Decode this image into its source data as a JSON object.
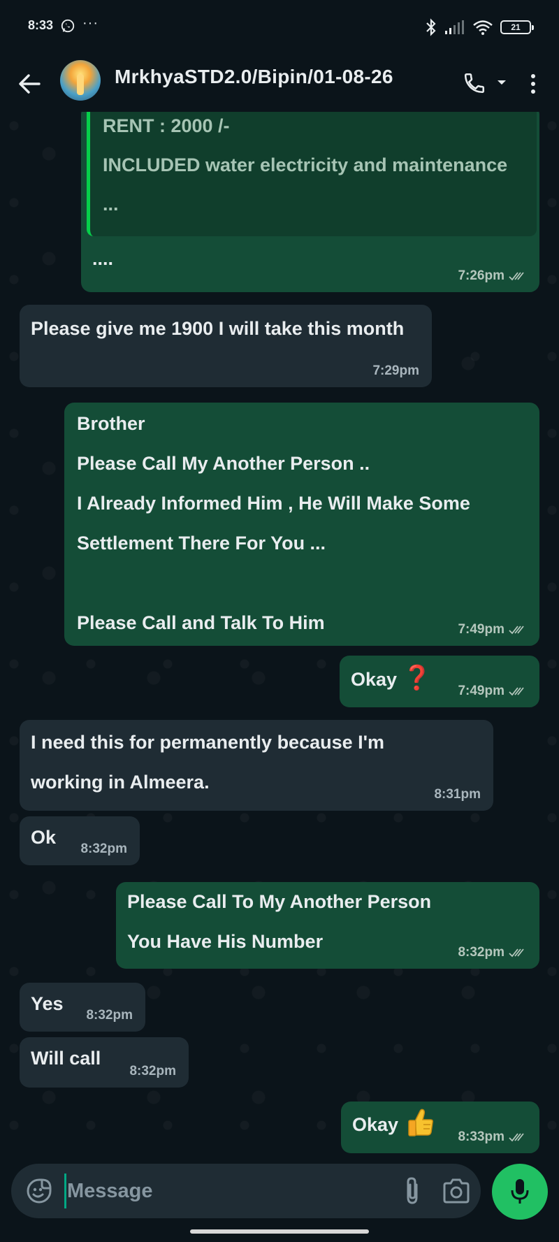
{
  "status_bar": {
    "time": "8:33",
    "dots": "···",
    "battery": "21"
  },
  "header": {
    "title": "MrkhyaSTD2.0/Bipin/01-08-26"
  },
  "messages": [
    {
      "id": "m1",
      "direction": "outgoing",
      "quoted_lines": [
        "RENT : 2000 /-",
        "INCLUDED water electricity and maintenance",
        "..."
      ],
      "text": "....",
      "time": "7:26pm",
      "status": "read"
    },
    {
      "id": "m2",
      "direction": "incoming",
      "text": "Please give me 1900 I will take this month",
      "time": "7:29pm"
    },
    {
      "id": "m3",
      "direction": "outgoing",
      "text": "Brother\nPlease Call My Another Person ..\nI Already Informed Him , He Will Make Some\nSettlement There For You ...\n\nPlease Call and Talk To Him",
      "time": "7:49pm",
      "status": "read"
    },
    {
      "id": "m4",
      "direction": "outgoing",
      "text": "Okay",
      "emoji": "❓",
      "time": "7:49pm",
      "status": "read"
    },
    {
      "id": "m5",
      "direction": "incoming",
      "text": "I need this for permanently because I'm\nworking in Almeera.",
      "time": "8:31pm"
    },
    {
      "id": "m6",
      "direction": "incoming",
      "text": "Ok",
      "time": "8:32pm"
    },
    {
      "id": "m7",
      "direction": "outgoing",
      "text": "Please Call To My Another Person\nYou Have His Number",
      "time": "8:32pm",
      "status": "read"
    },
    {
      "id": "m8",
      "direction": "incoming",
      "text": "Yes",
      "time": "8:32pm"
    },
    {
      "id": "m9",
      "direction": "incoming",
      "text": "Will call",
      "time": "8:32pm"
    },
    {
      "id": "m10",
      "direction": "outgoing",
      "text": "Okay",
      "emoji_icon": "thumbs-up-icon",
      "time": "8:33pm",
      "status": "read"
    }
  ],
  "input": {
    "placeholder": "Message"
  },
  "colors": {
    "background": "#0b141a",
    "outgoing_bubble": "#144d37",
    "incoming_bubble": "#1f2c34",
    "accent_green": "#21c063",
    "quote_bar": "#06cf4a"
  }
}
